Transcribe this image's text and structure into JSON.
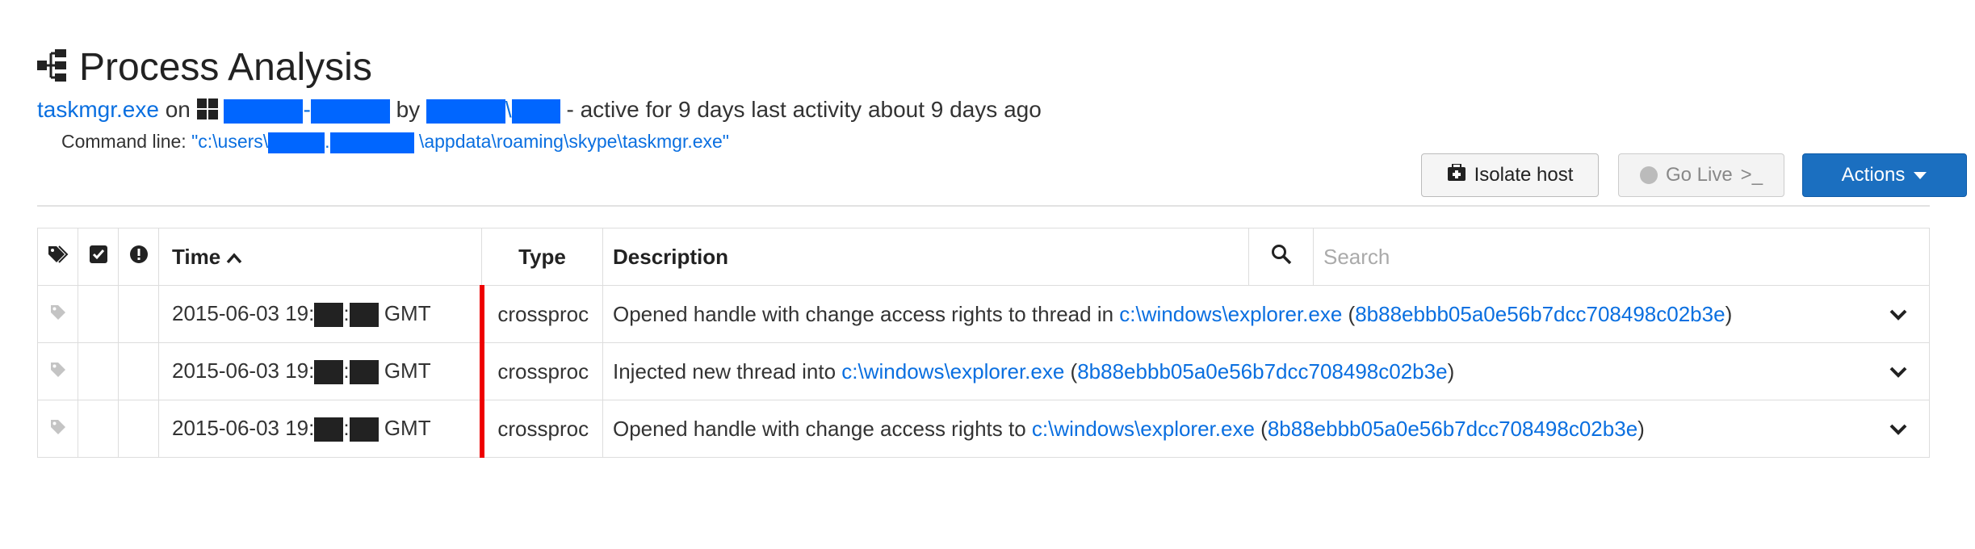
{
  "header": {
    "title": "Process Analysis",
    "process_name": "taskmgr.exe",
    "on_text": "on",
    "by_text": "by",
    "dash_text": "-",
    "backslash_text": "\\",
    "activity_text": "- active for 9 days last activity about 9 days ago",
    "command_label": "Command line:",
    "command_prefix": "\"c:\\users\\",
    "command_dot": ".",
    "command_suffix": " \\appdata\\roaming\\skype\\taskmgr.exe\""
  },
  "toolbar": {
    "isolate_label": "Isolate host",
    "golive_label": "Go Live",
    "golive_prompt": ">_",
    "actions_label": "Actions"
  },
  "table": {
    "headers": {
      "time": "Time",
      "type": "Type",
      "description": "Description"
    },
    "search_placeholder": "Search",
    "rows": [
      {
        "time_prefix": "2015-06-03 19:",
        "time_sep": ":",
        "time_suffix": " GMT",
        "type": "crossproc",
        "desc_prefix": "Opened handle with change access rights to thread in ",
        "desc_link": "c:\\windows\\explorer.exe",
        "desc_open": " (",
        "desc_hash": "8b88ebbb05a0e56b7dcc708498c02b3e",
        "desc_close": ")"
      },
      {
        "time_prefix": "2015-06-03 19:",
        "time_sep": ":",
        "time_suffix": " GMT",
        "type": "crossproc",
        "desc_prefix": "Injected new thread into ",
        "desc_link": "c:\\windows\\explorer.exe",
        "desc_open": " (",
        "desc_hash": "8b88ebbb05a0e56b7dcc708498c02b3e",
        "desc_close": ")"
      },
      {
        "time_prefix": "2015-06-03 19:",
        "time_sep": ":",
        "time_suffix": " GMT",
        "type": "crossproc",
        "desc_prefix": "Opened handle with change access rights to ",
        "desc_link": "c:\\windows\\explorer.exe",
        "desc_open": " (",
        "desc_hash": "8b88ebbb05a0e56b7dcc708498c02b3e",
        "desc_close": ")"
      }
    ]
  },
  "colors": {
    "link": "#0a6fe0",
    "accent_button": "#1b6fc0",
    "row_marker": "#ee0000",
    "redaction_blue": "#0066ff",
    "redaction_black": "#222222"
  },
  "icons": [
    "process-tree-icon",
    "windows-icon",
    "first-aid-kit-icon",
    "tags-icon",
    "checkbox-icon",
    "alert-icon",
    "sort-asc-icon",
    "search-icon",
    "tag-icon",
    "chevron-down-icon",
    "caret-down-icon"
  ]
}
